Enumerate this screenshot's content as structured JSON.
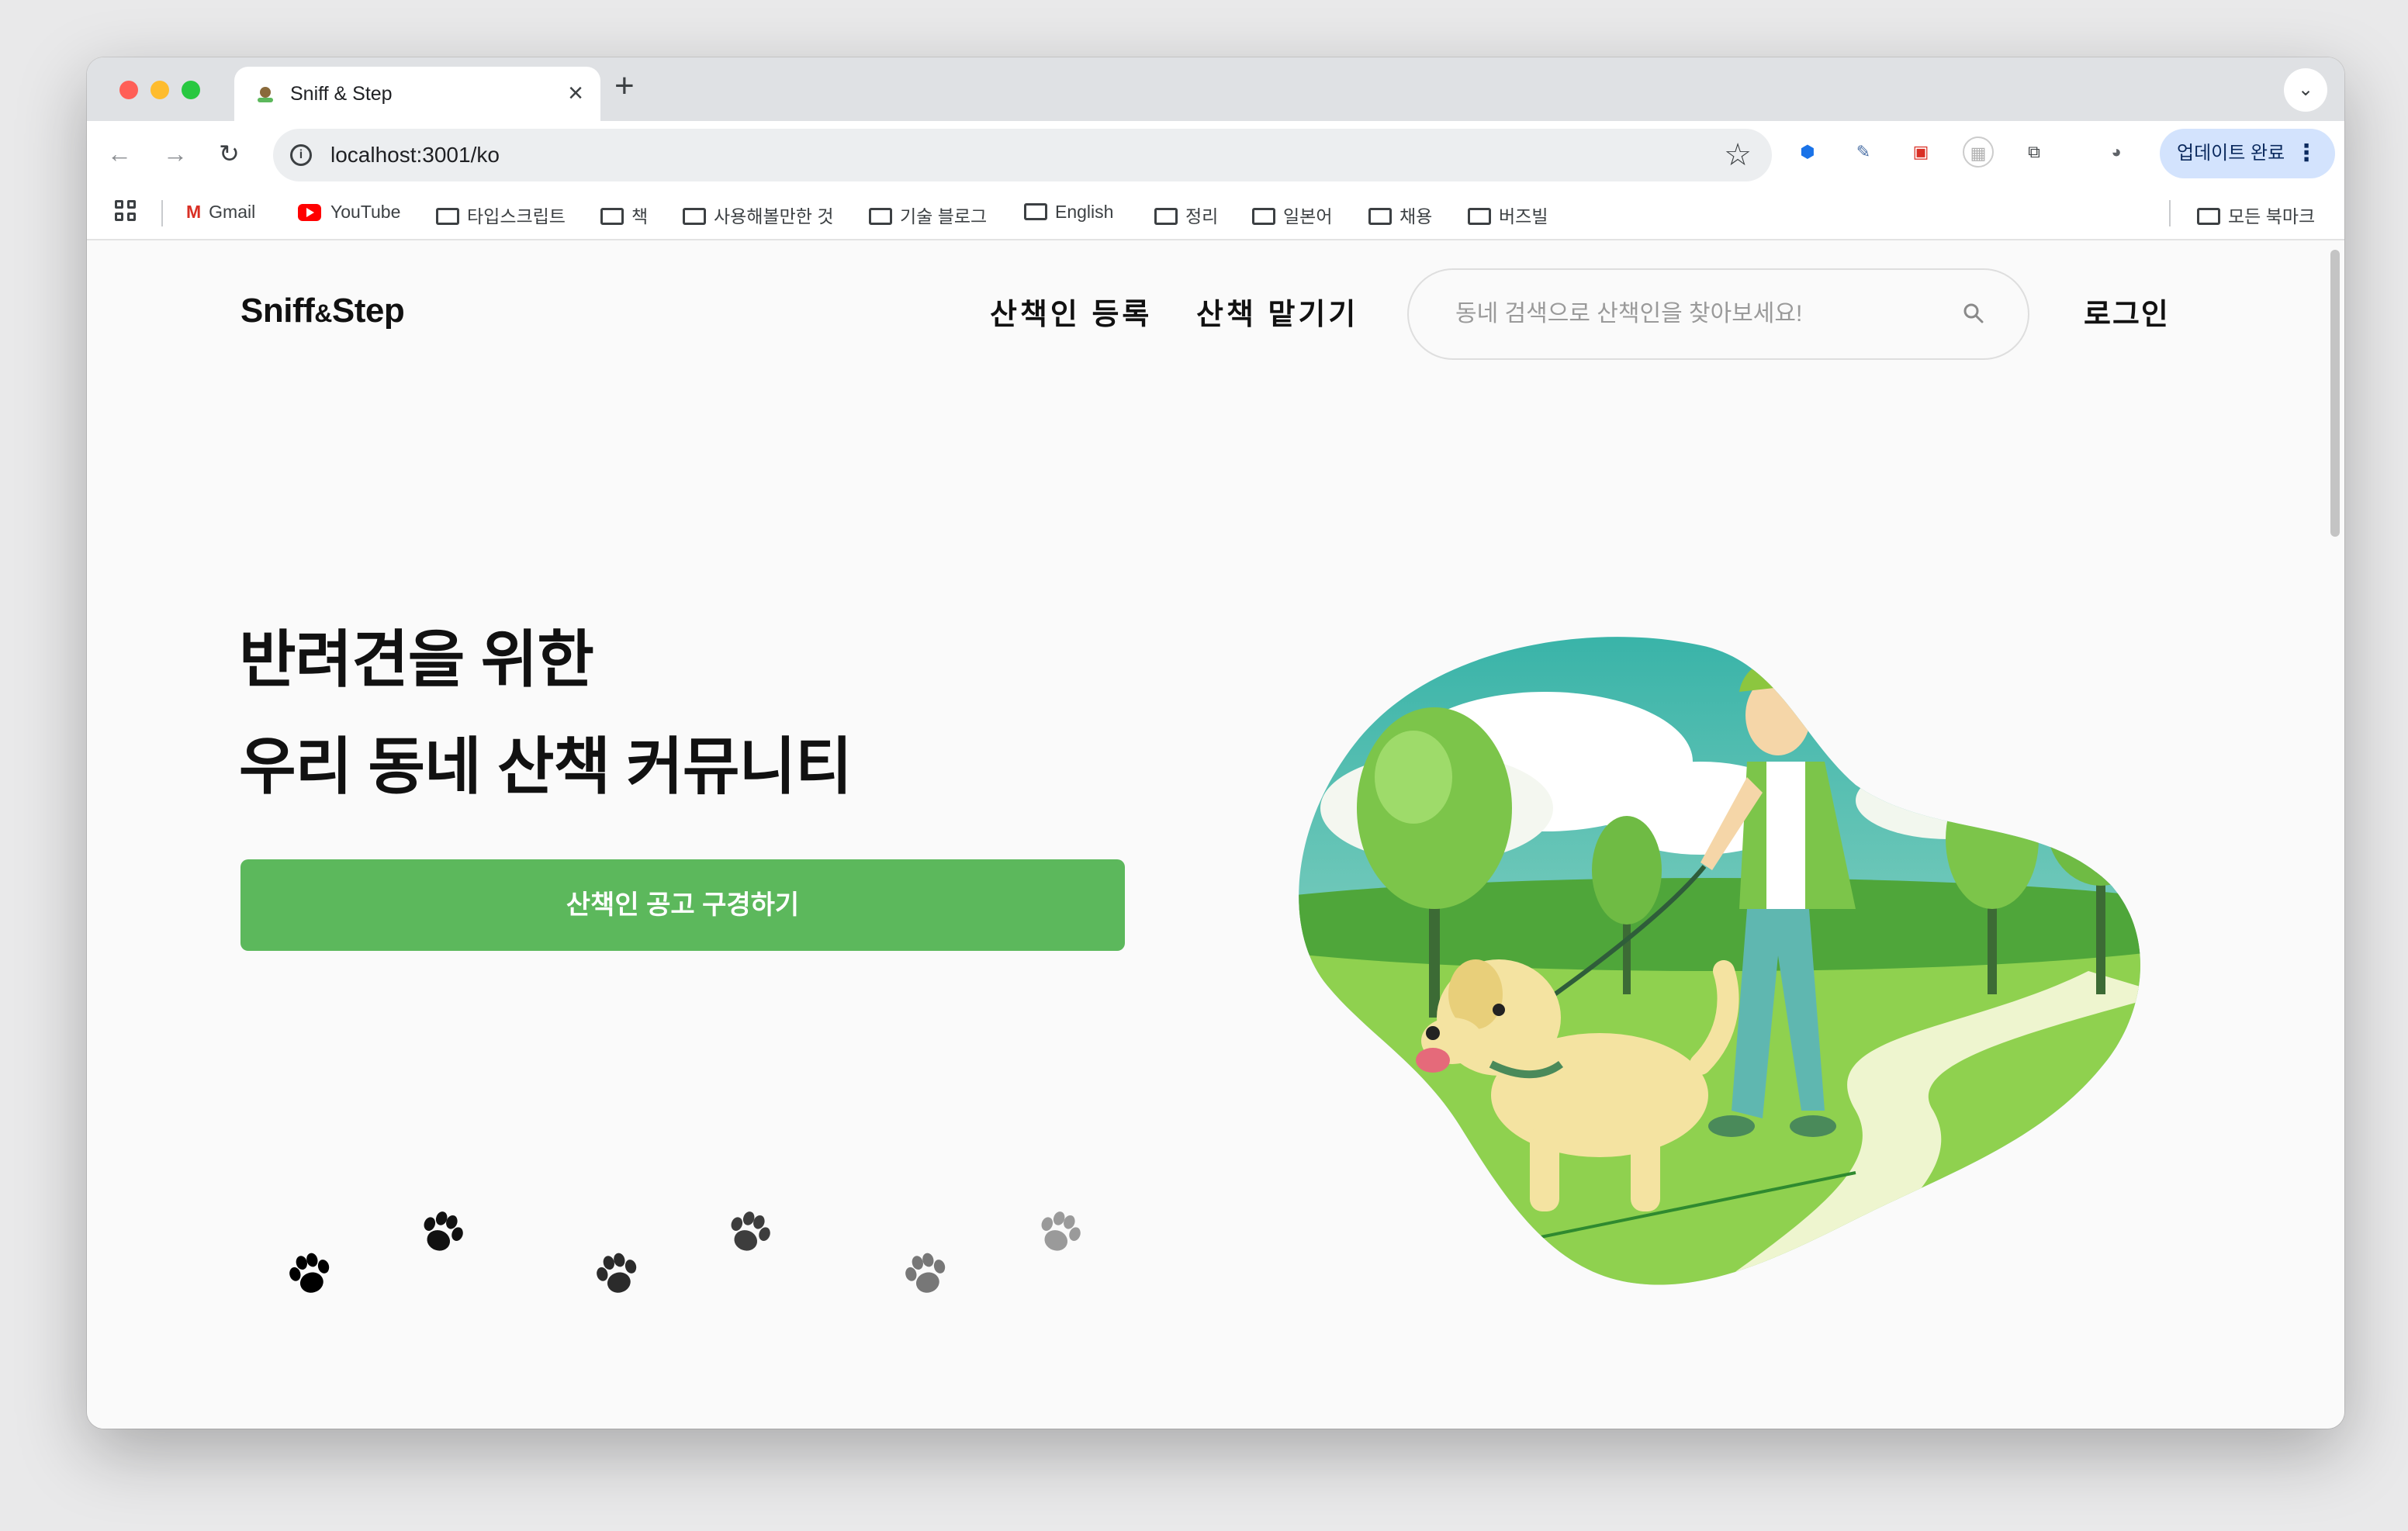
{
  "browser": {
    "tab_title": "Sniff & Step",
    "tab_close": "×",
    "new_tab": "+",
    "tabstrip_menu": "⌄",
    "url": "localhost:3001/ko",
    "update_button": "업데이트 완료",
    "update_dots": "⋮",
    "bookmarks": [
      {
        "label": "Gmail"
      },
      {
        "label": "YouTube"
      },
      {
        "label": "타입스크립트"
      },
      {
        "label": "책"
      },
      {
        "label": "사용해볼만한 것"
      },
      {
        "label": "기술 블로그"
      },
      {
        "label": "English"
      },
      {
        "label": "정리"
      },
      {
        "label": "일본어"
      },
      {
        "label": "채용"
      },
      {
        "label": "버즈빌"
      }
    ],
    "all_bookmarks": "모든 북마크"
  },
  "header": {
    "logo_main": "Sniff",
    "logo_amp": "&",
    "logo_tail": "Step",
    "nav": {
      "register": "산책인 등록",
      "match": "산책 맡기기"
    },
    "search_placeholder": "동네 검색으로 산책인을 찾아보세요!",
    "login": "로그인"
  },
  "hero": {
    "title_line1": "반려견을 위한",
    "title_line2": "우리 동네 산책 커뮤니티",
    "cta": "산책인 공고 구경하기"
  },
  "colors": {
    "accent_green": "#5cb85c",
    "paw_shades": [
      "#000000",
      "#1a1a1a",
      "#2b2b2b",
      "#3d3d3d",
      "#777777",
      "#9a9a9a"
    ]
  },
  "icons": {
    "search": "magnifier-icon",
    "paw": "paw-print-icon"
  }
}
